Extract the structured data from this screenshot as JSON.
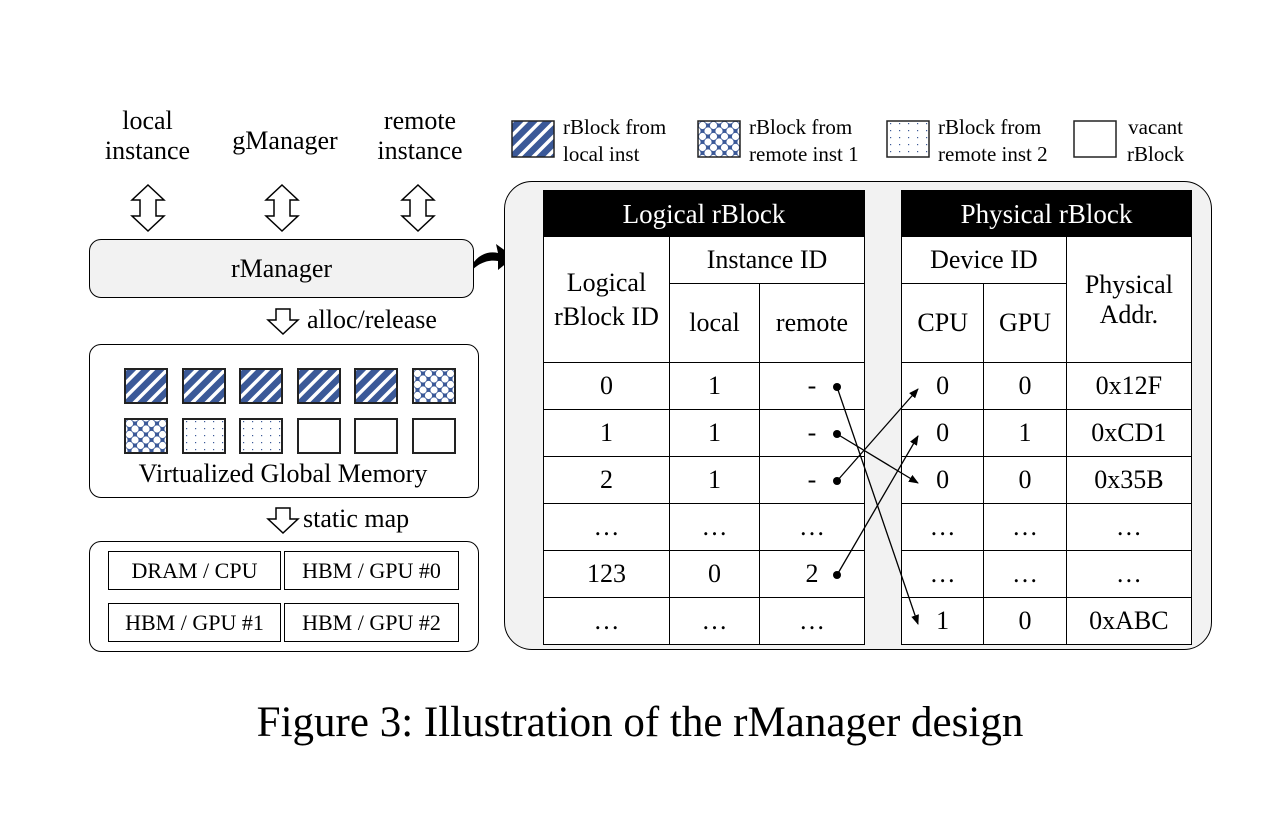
{
  "top_labels": {
    "local_instance": "local\ninstance",
    "gmanager": "gManager",
    "remote_instance": "remote\ninstance"
  },
  "rmanager_label": "rManager",
  "alloc_release_label": "alloc/release",
  "static_map_label": "static map",
  "virtual_memory": {
    "label": "Virtualized Global Memory",
    "blocks_row1": [
      "local",
      "local",
      "local",
      "local",
      "local",
      "remote1"
    ],
    "blocks_row2": [
      "remote1",
      "remote2",
      "remote2",
      "vacant",
      "vacant",
      "vacant"
    ]
  },
  "devices": [
    "DRAM / CPU",
    "HBM / GPU #0",
    "HBM / GPU #1",
    "HBM / GPU #2"
  ],
  "legend": [
    {
      "pattern": "local",
      "line1": "rBlock from",
      "line2": "local inst"
    },
    {
      "pattern": "remote1",
      "line1": "rBlock from",
      "line2": "remote inst 1"
    },
    {
      "pattern": "remote2",
      "line1": "rBlock from",
      "line2": "remote inst 2"
    },
    {
      "pattern": "vacant",
      "line1": "vacant",
      "line2": "rBlock"
    }
  ],
  "logical_table": {
    "title": "Logical rBlock",
    "col_id": "Logical rBlock ID",
    "col_instance": "Instance ID",
    "col_local": "local",
    "col_remote": "remote",
    "rows": [
      {
        "id": "0",
        "local": "1",
        "remote": "-"
      },
      {
        "id": "1",
        "local": "1",
        "remote": "-"
      },
      {
        "id": "2",
        "local": "1",
        "remote": "-"
      },
      {
        "id": "…",
        "local": "…",
        "remote": "…"
      },
      {
        "id": "123",
        "local": "0",
        "remote": "2"
      },
      {
        "id": "…",
        "local": "…",
        "remote": "…"
      }
    ]
  },
  "physical_table": {
    "title": "Physical rBlock",
    "col_device": "Device ID",
    "col_cpu": "CPU",
    "col_gpu": "GPU",
    "col_addr": "Physical Addr.",
    "rows": [
      {
        "cpu": "0",
        "gpu": "0",
        "addr": "0x12F"
      },
      {
        "cpu": "0",
        "gpu": "1",
        "addr": "0xCD1"
      },
      {
        "cpu": "0",
        "gpu": "0",
        "addr": "0x35B"
      },
      {
        "cpu": "…",
        "gpu": "…",
        "addr": "…"
      },
      {
        "cpu": "…",
        "gpu": "…",
        "addr": "…"
      },
      {
        "cpu": "1",
        "gpu": "0",
        "addr": "0xABC"
      }
    ]
  },
  "mappings": [
    {
      "from_logical_row": 0,
      "to_physical_row": 5
    },
    {
      "from_logical_row": 1,
      "to_physical_row": 2
    },
    {
      "from_logical_row": 2,
      "to_physical_row": 0
    },
    {
      "from_logical_row": 4,
      "to_physical_row": 1
    }
  ],
  "colors": {
    "pattern_blue": "#3b5998",
    "panel_gray": "#f2f2f2"
  },
  "caption": "Figure 3: Illustration of the rManager design"
}
